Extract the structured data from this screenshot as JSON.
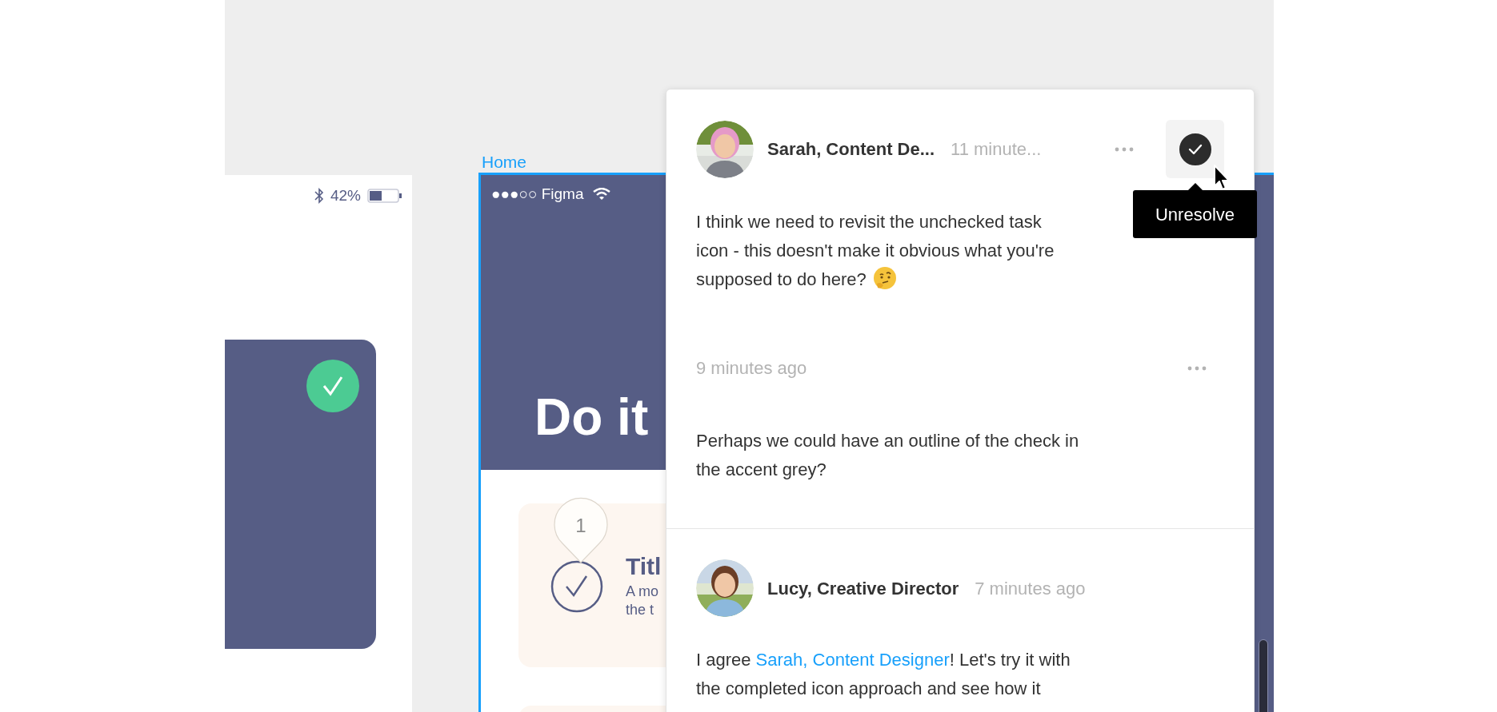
{
  "left_frame": {
    "battery": "42%",
    "card_checked": true
  },
  "home_frame": {
    "label": "Home",
    "selected": true,
    "carrier": "●●●○○ Figma",
    "heading": "Do it",
    "task": {
      "title": "Titl",
      "description_lines": [
        "A mo",
        "the t"
      ],
      "checked": true
    },
    "comment_pin": "1"
  },
  "thread": {
    "resolved": true,
    "tooltip": "Unresolve",
    "comments": [
      {
        "kind": "header",
        "author": "Sarah, Content De...",
        "time": "11 minute...",
        "menu": true,
        "body": [
          [
            {
              "kind": "text",
              "text": "I think we need to revisit the unchecked task"
            }
          ],
          [
            {
              "kind": "text",
              "text": "icon - this doesn't make it obvious what you're"
            }
          ],
          [
            {
              "kind": "text",
              "text": "supposed to do here?"
            },
            {
              "kind": "emoji"
            }
          ]
        ]
      },
      {
        "kind": "reply",
        "time": "9 minutes ago",
        "menu": true,
        "body": [
          [
            {
              "kind": "text",
              "text": "Perhaps we could have an outline of the check in"
            }
          ],
          [
            {
              "kind": "text",
              "text": "the accent grey?"
            }
          ]
        ]
      },
      {
        "kind": "header",
        "author": "Lucy, Creative Director",
        "time": "7 minutes ago",
        "menu": false,
        "body": [
          [
            {
              "kind": "text",
              "text": "I agree "
            },
            {
              "kind": "mention",
              "text": "Sarah, Content Designer"
            },
            {
              "kind": "text",
              "text": "! Let's try it with"
            }
          ],
          [
            {
              "kind": "text",
              "text": "the completed icon approach and see how it"
            }
          ]
        ]
      }
    ]
  }
}
